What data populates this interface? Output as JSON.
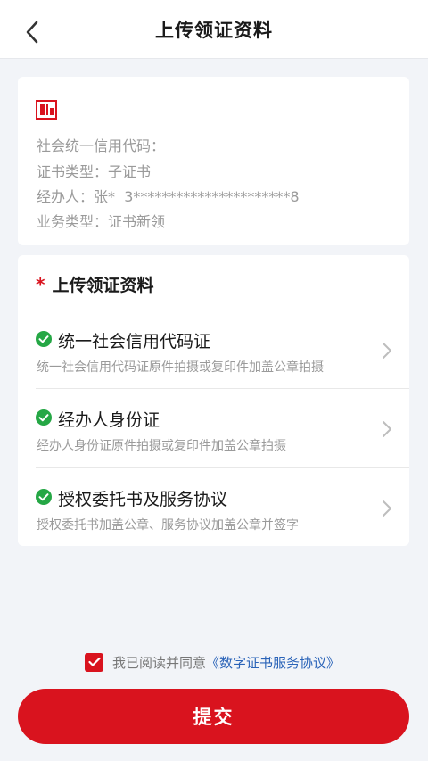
{
  "header": {
    "title": "上传领证资料",
    "back_icon": "chevron-left-icon"
  },
  "info": {
    "logo_icon": "red-building-logo",
    "credit_code_label": "社会统一信用代码：",
    "credit_code_value": "",
    "cert_type_label": "证书类型：",
    "cert_type_value": "子证书",
    "operator_label": "经办人：",
    "operator_value": "张*  3**********************8",
    "business_type_label": "业务类型：",
    "business_type_value": "证书新领"
  },
  "upload": {
    "required_mark": "*",
    "title": "上传领证资料",
    "items": [
      {
        "title": "统一社会信用代码证",
        "desc": "统一社会信用代码证原件拍摄或复印件加盖公章拍摄",
        "status": "checked"
      },
      {
        "title": "经办人身份证",
        "desc": "经办人身份证原件拍摄或复印件加盖公章拍摄",
        "status": "checked"
      },
      {
        "title": "授权委托书及服务协议",
        "desc": "授权委托书加盖公章、服务协议加盖公章并签字",
        "status": "checked"
      }
    ]
  },
  "agreement": {
    "checked": true,
    "text": "我已阅读并同意",
    "link": "《数字证书服务协议》"
  },
  "submit_label": "提交",
  "colors": {
    "accent": "#d9131e",
    "check_green": "#25a745",
    "link_blue": "#2a63b8"
  }
}
